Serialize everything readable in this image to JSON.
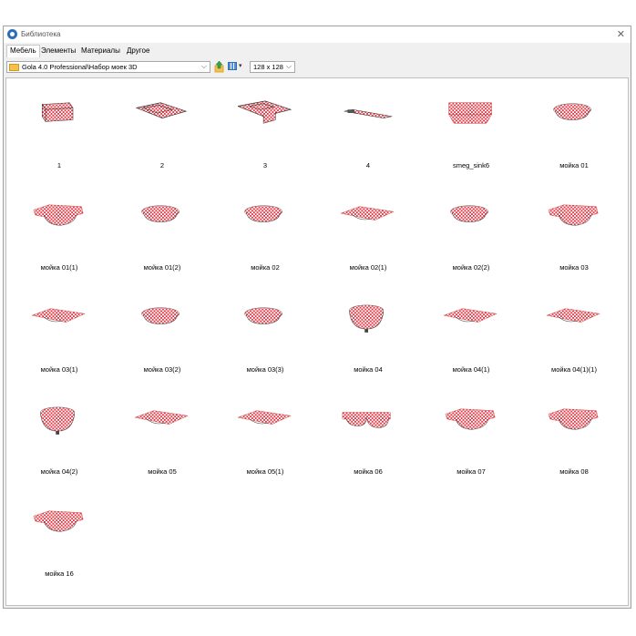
{
  "window": {
    "title": "Библиотека",
    "close_glyph": "✕"
  },
  "tabs": [
    "Мебель",
    "Элементы",
    "Материалы",
    "Другое"
  ],
  "active_tab": "Мебель",
  "toolbar": {
    "path": "Gola 4.0 Professional\\Набор моек 3D",
    "combo_arrow": "⌵",
    "view_arrow": "▾",
    "thumb_size": "128 x 128",
    "icons": [
      "folder-icon",
      "folder-up-icon",
      "view-mode-icon"
    ]
  },
  "colors": {
    "checker_red": "#e03a46",
    "checker_white": "#ffffff",
    "accent": "#2b6fb6"
  },
  "items": [
    {
      "label": "1",
      "shape": "box"
    },
    {
      "label": "2",
      "shape": "flat-tray"
    },
    {
      "label": "3",
      "shape": "double-tray"
    },
    {
      "label": "4",
      "shape": "strip"
    },
    {
      "label": "smeg_sink6",
      "shape": "rect-sink"
    },
    {
      "label": "мойка 01",
      "shape": "round-bowl"
    },
    {
      "label": "мойка 01(1)",
      "shape": "wide-bowl"
    },
    {
      "label": "мойка 01(2)",
      "shape": "round-bowl"
    },
    {
      "label": "мойка 02",
      "shape": "round-bowl"
    },
    {
      "label": "мойка 02(1)",
      "shape": "flat-wing"
    },
    {
      "label": "мойка 02(2)",
      "shape": "round-bowl"
    },
    {
      "label": "мойка 03",
      "shape": "wide-bowl"
    },
    {
      "label": "мойка 03(1)",
      "shape": "flat-wing"
    },
    {
      "label": "мойка 03(2)",
      "shape": "round-bowl"
    },
    {
      "label": "мойка 03(3)",
      "shape": "round-bowl"
    },
    {
      "label": "мойка 04",
      "shape": "deep-bowl"
    },
    {
      "label": "мойка 04(1)",
      "shape": "flat-wing"
    },
    {
      "label": "мойка 04(1)(1)",
      "shape": "flat-wing"
    },
    {
      "label": "мойка 04(2)",
      "shape": "deep-bowl"
    },
    {
      "label": "мойка 05",
      "shape": "flat-wing"
    },
    {
      "label": "мойка 05(1)",
      "shape": "flat-wing"
    },
    {
      "label": "мойка 06",
      "shape": "double-bowl"
    },
    {
      "label": "мойка 07",
      "shape": "wide-bowl"
    },
    {
      "label": "мойка 08",
      "shape": "wide-bowl"
    },
    {
      "label": "мойка 16",
      "shape": "wide-bowl"
    }
  ]
}
